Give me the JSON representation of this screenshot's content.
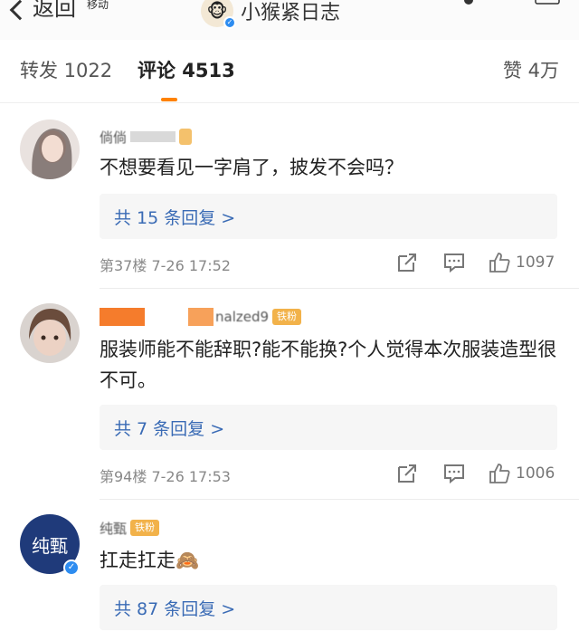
{
  "header": {
    "back_label": "返回",
    "title": "小猴紧日志",
    "status_fragment": "移动"
  },
  "tabs": [
    {
      "label": "转发 1022"
    },
    {
      "label": "评论 4513"
    },
    {
      "label": "赞 4万"
    }
  ],
  "comments": [
    {
      "name_fragment": "倘倘",
      "text": "不想要看见一字肩了，披发不会吗？",
      "reply_label": "共 15 条回复 >",
      "meta": "第37楼 7-26 17:52",
      "likes": "1097"
    },
    {
      "name_fragment": "nalzed9",
      "badge": "铁粉",
      "text": "服装师能不能辞职?能不能换?个人觉得本次服装造型很不可。",
      "reply_label": "共 7 条回复 >",
      "meta": "第94楼 7-26 17:53",
      "likes": "1006"
    },
    {
      "name_fragment": "纯甄",
      "avatar_text": "纯甄",
      "badge": "铁粉",
      "text": "扛走扛走🙈",
      "reply_label": "共 87 条回复 >"
    }
  ],
  "icon_names": [
    "back-chevron-icon",
    "share-icon",
    "comment-icon",
    "like-icon",
    "verified-icon"
  ],
  "colors": {
    "accent": "#ff8200",
    "link": "#3a6bb5",
    "badge": "#f2b24a",
    "verified": "#2d8cf0"
  }
}
